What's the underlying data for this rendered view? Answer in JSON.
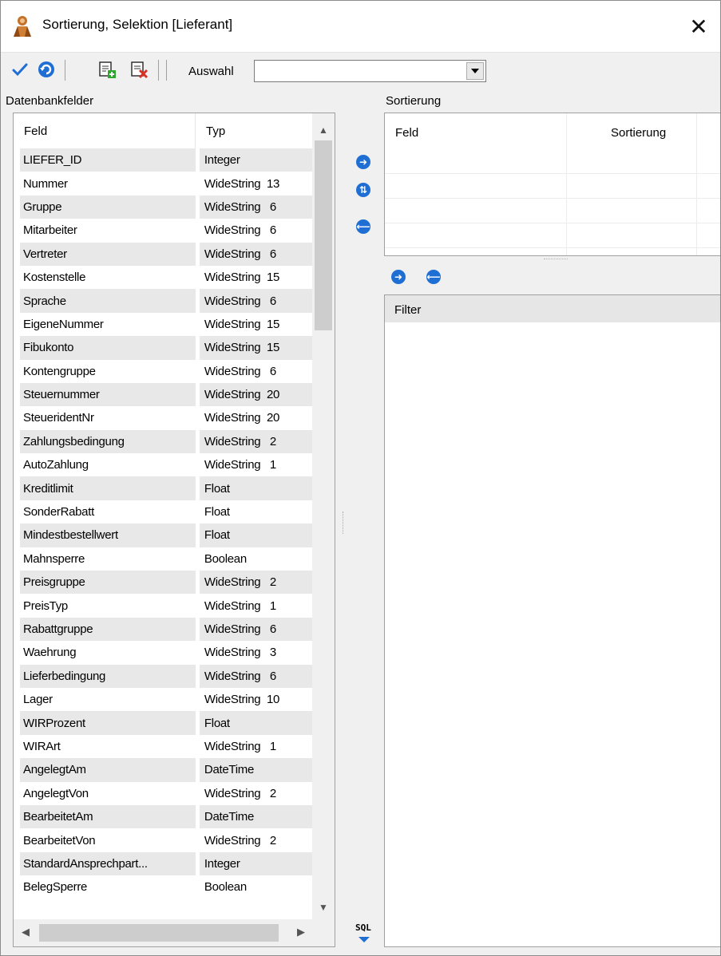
{
  "window": {
    "title": "Sortierung, Selektion [Lieferant]",
    "close_symbol": "✕"
  },
  "toolbar": {
    "icons": [
      "check-icon",
      "undo-icon",
      "add-list-icon",
      "delete-list-icon"
    ],
    "auswahl_label": "Auswahl",
    "auswahl_value": ""
  },
  "left": {
    "label": "Datenbankfelder",
    "columns": [
      "Feld",
      "Typ"
    ],
    "rows": [
      {
        "feld": "LIEFER_ID",
        "typ": "Integer"
      },
      {
        "feld": "Nummer",
        "typ": "WideString  13"
      },
      {
        "feld": "Gruppe",
        "typ": "WideString   6"
      },
      {
        "feld": "Mitarbeiter",
        "typ": "WideString   6"
      },
      {
        "feld": "Vertreter",
        "typ": "WideString   6"
      },
      {
        "feld": "Kostenstelle",
        "typ": "WideString  15"
      },
      {
        "feld": "Sprache",
        "typ": "WideString   6"
      },
      {
        "feld": "EigeneNummer",
        "typ": "WideString  15"
      },
      {
        "feld": "Fibukonto",
        "typ": "WideString  15"
      },
      {
        "feld": "Kontengruppe",
        "typ": "WideString   6"
      },
      {
        "feld": "Steuernummer",
        "typ": "WideString  20"
      },
      {
        "feld": "SteueridentNr",
        "typ": "WideString  20"
      },
      {
        "feld": "Zahlungsbedingung",
        "typ": "WideString   2"
      },
      {
        "feld": "AutoZahlung",
        "typ": "WideString   1"
      },
      {
        "feld": "Kreditlimit",
        "typ": "Float"
      },
      {
        "feld": "SonderRabatt",
        "typ": "Float"
      },
      {
        "feld": "Mindestbestellwert",
        "typ": "Float"
      },
      {
        "feld": "Mahnsperre",
        "typ": "Boolean"
      },
      {
        "feld": "Preisgruppe",
        "typ": "WideString   2"
      },
      {
        "feld": "PreisTyp",
        "typ": "WideString   1"
      },
      {
        "feld": "Rabattgruppe",
        "typ": "WideString   6"
      },
      {
        "feld": "Waehrung",
        "typ": "WideString   3"
      },
      {
        "feld": "Lieferbedingung",
        "typ": "WideString   6"
      },
      {
        "feld": "Lager",
        "typ": "WideString  10"
      },
      {
        "feld": "WIRProzent",
        "typ": "Float"
      },
      {
        "feld": "WIRArt",
        "typ": "WideString   1"
      },
      {
        "feld": "AngelegtAm",
        "typ": "DateTime"
      },
      {
        "feld": "AngelegtVon",
        "typ": "WideString   2"
      },
      {
        "feld": "BearbeitetAm",
        "typ": "DateTime"
      },
      {
        "feld": "BearbeitetVon",
        "typ": "WideString   2"
      },
      {
        "feld": "StandardAnsprechpart...",
        "typ": "Integer"
      },
      {
        "feld": "BelegSperre",
        "typ": "Boolean"
      }
    ]
  },
  "arrows": {
    "add": "➜",
    "swap": "⇅",
    "remove": "⟵",
    "add_filter": "➜",
    "remove_filter": "⟵"
  },
  "sort": {
    "label": "Sortierung",
    "columns": [
      "Feld",
      "Sortierung"
    ]
  },
  "filter": {
    "header": "Filter"
  },
  "sql": {
    "label": "SQL"
  },
  "colors": {
    "accent": "#1f6ed4",
    "alt_row": "#e8e8e8",
    "window_bg": "#f0f0f0"
  }
}
